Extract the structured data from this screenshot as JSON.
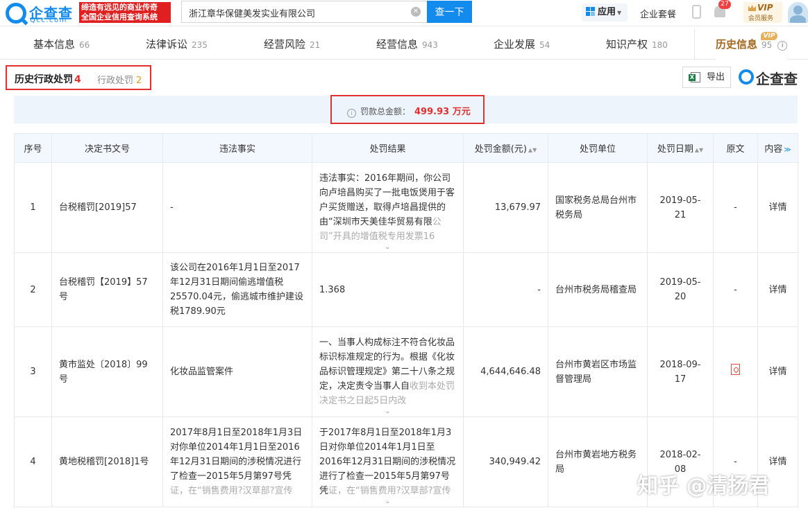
{
  "topbar": {
    "logo_name": "企查查",
    "logo_domain": "Qcc.com",
    "slogan_line1": "缔造有远见的商业传奇",
    "slogan_line2": "全国企业信用查询系统",
    "search_value": "浙江章华保健美发实业有限公司",
    "search_button": "查一下",
    "app_label": "应用",
    "suite_label": "企业套餐",
    "bell_count": "27",
    "vip_label": "VIP",
    "vip_sub": "会员服务"
  },
  "nav": {
    "tabs": [
      {
        "label": "基本信息",
        "count": "66"
      },
      {
        "label": "法律诉讼",
        "count": "235"
      },
      {
        "label": "经营风险",
        "count": "21"
      },
      {
        "label": "经营信息",
        "count": "943"
      },
      {
        "label": "企业发展",
        "count": "54"
      },
      {
        "label": "知识产权",
        "count": "180"
      },
      {
        "label": "历史信息",
        "count": "95"
      }
    ],
    "vip_tag": "VIP"
  },
  "subtabs": {
    "active_label": "历史行政处罚",
    "active_count": "4",
    "other_label": "行政处罚",
    "other_count": "2"
  },
  "toolbar": {
    "export_label": "导出",
    "brand_name": "企查查"
  },
  "summary": {
    "label": "罚款总金额：",
    "amount": "499.93 万元"
  },
  "table": {
    "headers": {
      "idx": "序号",
      "doc_no": "决定书文号",
      "fact": "违法事实",
      "result": "处罚结果",
      "amount": "处罚金额(元)",
      "unit": "处罚单位",
      "date": "处罚日期",
      "original": "原文",
      "content": "内容"
    },
    "rows": [
      {
        "idx": "1",
        "doc_no": "台税稽罚[2019]57",
        "fact": "-",
        "result": "违法事实：2016年期间，你公司向卢培昌购买了一批电饭煲用于客户买货赠送，取得卢培昌提供的由“深圳市天美佳华贸易有限",
        "result_fade": "公司”开具的增值税专用发票16",
        "amount": "13,679.97",
        "unit": "国家税务总局台州市税务局",
        "date": "2019-05-21",
        "original": "-",
        "detail": "详情"
      },
      {
        "idx": "2",
        "doc_no": "台税稽罚【2019】57号",
        "fact": "该公司在2016年1月1日至2017年12月31日期间偷逃增值税25570.04元，偷逃城市维护建设税1789.90元",
        "result": "1.368",
        "amount": "-",
        "unit": "台州市税务局稽查局",
        "date": "2019-05-20",
        "original": "-",
        "detail": "详情"
      },
      {
        "idx": "3",
        "doc_no": "黄市监处〔2018〕99号",
        "fact": "化妆品监管案件",
        "result": "一、当事人构成标注不符合化妆品标识标准规定的行为。根据《化妆品标识管理规定》第二十八条之规定，决定责令当事人自",
        "result_fade": "收到本处罚决定书之日起5日内改",
        "amount": "4,644,646.48",
        "unit": "台州市黄岩区市场监督管理局",
        "date": "2018-09-17",
        "detail": "详情"
      },
      {
        "idx": "4",
        "doc_no": "黄地税稽罚[2018]1号",
        "fact": "2017年8月1日至2018年1月3日对你单位2014年1月1日至2016年12月31日期间的涉税情况进行了检查一2015年5月第97号凭",
        "fact_fade": "证，在“销售费用?汉草部?宣传",
        "result": "于2017年8月1日至2018年1月3日对你单位2014年1月1日至2016年12月31日期间的涉税情况进行了检查一2015年5月第97号凭",
        "result_fade": "证，在“销售费用?汉草部?宣传",
        "amount": "340,949.42",
        "unit": "台州市黄岩地方税务局",
        "date": "2018-02-08",
        "original": "-",
        "detail": "详情"
      }
    ]
  },
  "watermark": "知乎 @清扬君",
  "colors": {
    "brand_blue": "#128bed",
    "highlight_red": "#e03030",
    "vip_gold": "#a0681e"
  }
}
